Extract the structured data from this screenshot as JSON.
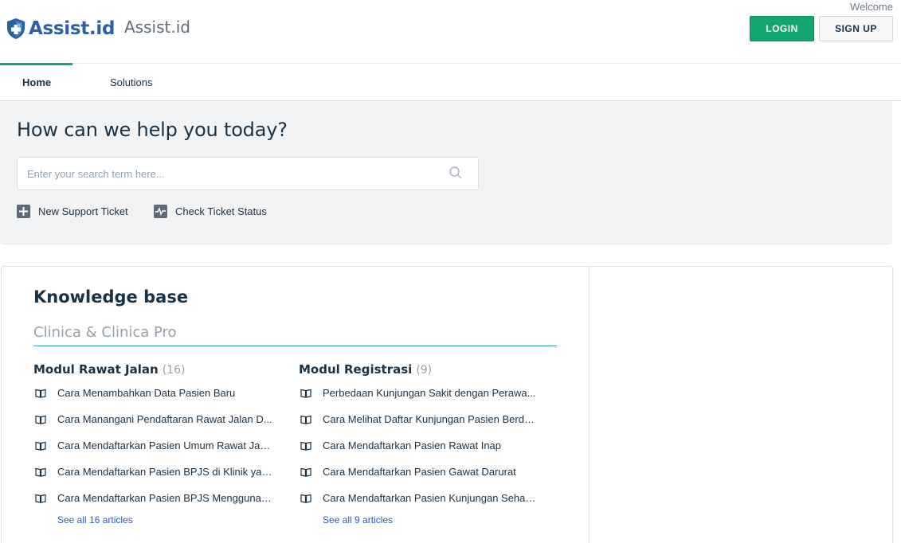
{
  "header": {
    "logo_text": "Assist.id",
    "portal_name": "Assist.id",
    "welcome": "Welcome",
    "login_label": "LOGIN",
    "signup_label": "SIGN UP"
  },
  "nav": {
    "tabs": [
      {
        "label": "Home",
        "active": true
      },
      {
        "label": "Solutions",
        "active": false
      }
    ]
  },
  "hero": {
    "title": "How can we help you today?",
    "search_placeholder": "Enter your search term here...",
    "new_ticket_label": "New Support Ticket",
    "check_status_label": "Check Ticket Status"
  },
  "knowledge_base": {
    "title": "Knowledge base",
    "category": "Clinica & Clinica Pro",
    "folders": [
      {
        "title": "Modul Rawat Jalan",
        "count": "(16)",
        "articles": [
          "Cara Menambahkan Data Pasien Baru",
          "Cara Manangani Pendaftaran Rawat Jalan D...",
          "Cara Mendaftarkan Pasien Umum Rawat Jalan",
          "Cara Mendaftarkan Pasien BPJS di Klinik yan...",
          "Cara Mendaftarkan Pasien BPJS Menggunak..."
        ],
        "see_all": "See all 16 articles"
      },
      {
        "title": "Modul Registrasi",
        "count": "(9)",
        "articles": [
          "Perbedaan Kunjungan Sakit dengan Perawa...",
          "Cara Melihat Daftar Kunjungan Pasien Berda...",
          "Cara Mendaftarkan Pasien Rawat Inap",
          "Cara Mendaftarkan Pasien Gawat Darurat",
          "Cara Mendaftarkan Pasien Kunjungan Sehat ..."
        ],
        "see_all": "See all 9 articles"
      }
    ]
  },
  "colors": {
    "brand_blue": "#2b5fa6",
    "login_green": "#12a670",
    "link_blue": "#2c5cc5",
    "accent_teal": "#2c9cb8"
  }
}
